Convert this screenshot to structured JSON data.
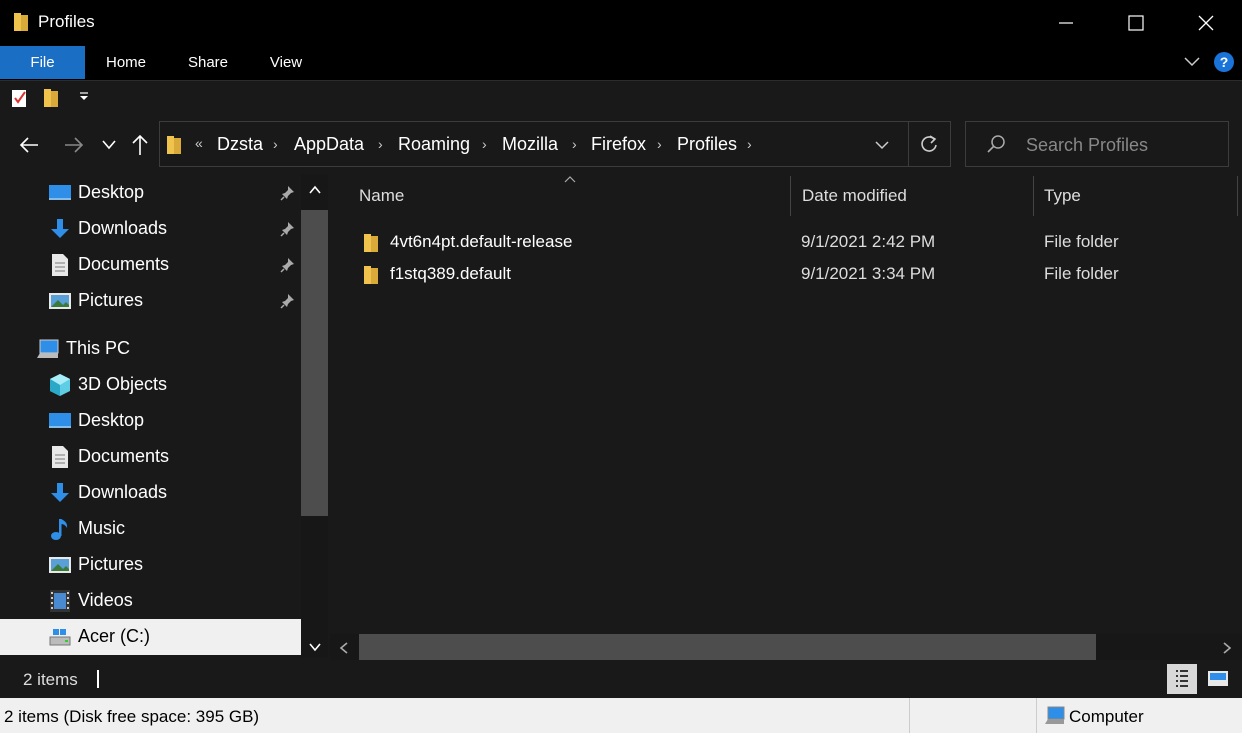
{
  "window": {
    "title": "Profiles"
  },
  "ribbon": {
    "tabs": [
      "File",
      "Home",
      "Share",
      "View"
    ]
  },
  "breadcrumb": {
    "overflow": "«",
    "items": [
      "Dzsta",
      "AppData",
      "Roaming",
      "Mozilla",
      "Firefox",
      "Profiles"
    ]
  },
  "search": {
    "placeholder": "Search Profiles"
  },
  "nav": {
    "quick_access": [
      {
        "label": "Desktop",
        "icon": "desktop-icon"
      },
      {
        "label": "Downloads",
        "icon": "downloads-icon"
      },
      {
        "label": "Documents",
        "icon": "documents-icon"
      },
      {
        "label": "Pictures",
        "icon": "pictures-icon"
      }
    ],
    "this_pc": "This PC",
    "pc_items": [
      {
        "label": "3D Objects",
        "icon": "3d-objects-icon"
      },
      {
        "label": "Desktop",
        "icon": "desktop-icon"
      },
      {
        "label": "Documents",
        "icon": "documents-icon"
      },
      {
        "label": "Downloads",
        "icon": "downloads-icon"
      },
      {
        "label": "Music",
        "icon": "music-icon"
      },
      {
        "label": "Pictures",
        "icon": "pictures-icon"
      },
      {
        "label": "Videos",
        "icon": "videos-icon"
      },
      {
        "label": "Acer (C:)",
        "icon": "drive-icon"
      }
    ]
  },
  "columns": {
    "name": "Name",
    "date": "Date modified",
    "type": "Type"
  },
  "files": [
    {
      "name": "4vt6n4pt.default-release",
      "date": "9/1/2021 2:42 PM",
      "type": "File folder"
    },
    {
      "name": "f1stq389.default",
      "date": "9/1/2021 3:34 PM",
      "type": "File folder"
    }
  ],
  "status": {
    "items": "2 items"
  },
  "details_bar": {
    "info": "2 items (Disk free space: 395 GB)",
    "location": "Computer"
  },
  "colors": {
    "accent": "#1a6fc4",
    "folder": "#f0c44c",
    "background": "#191919"
  }
}
